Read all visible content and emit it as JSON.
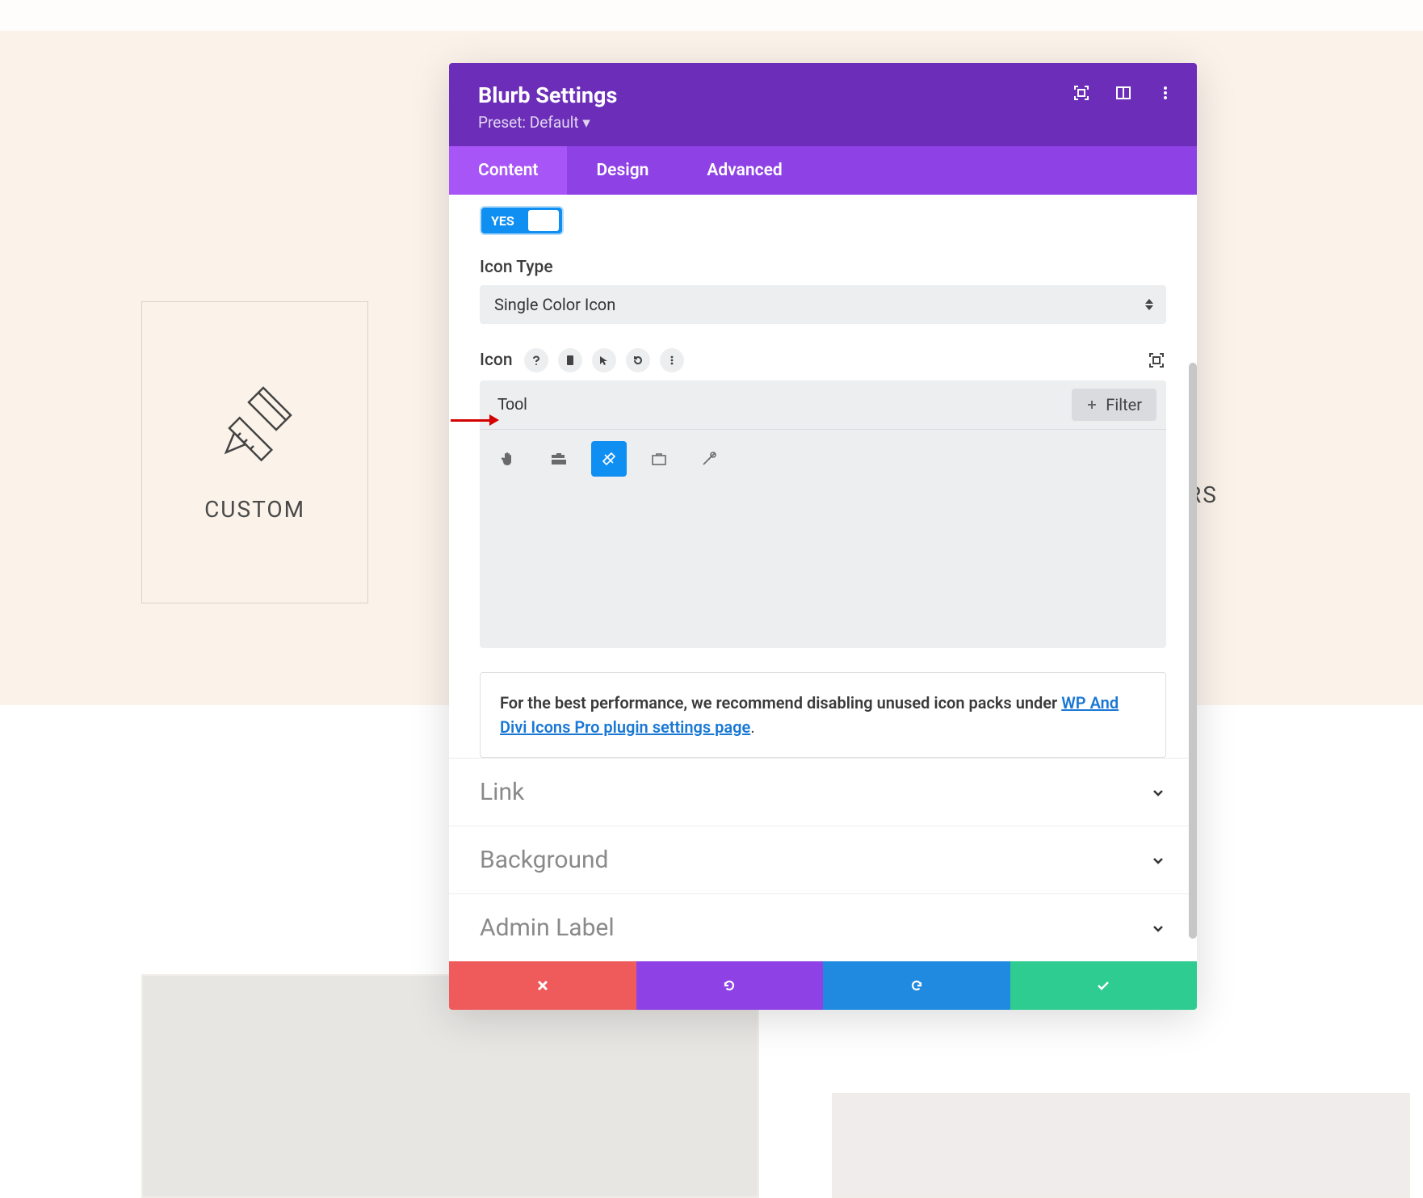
{
  "page": {
    "cards": [
      {
        "label": "CUSTOM"
      },
      {
        "label": "REPAIRS"
      }
    ]
  },
  "modal": {
    "title": "Blurb Settings",
    "preset": "Preset: Default ▾",
    "tabs": {
      "content": "Content",
      "design": "Design",
      "advanced": "Advanced"
    },
    "toggle": {
      "value": "YES"
    },
    "icon_type_label": "Icon Type",
    "icon_type_value": "Single Color Icon",
    "icon_label": "Icon",
    "search_value": "Tool",
    "filter_label": "Filter",
    "icons": [
      "hand-icon",
      "toolbox-icon",
      "pencil-ruler-icon",
      "briefcase-icon",
      "wrench-screwdriver-icon"
    ],
    "selected_icon_index": 2,
    "info": {
      "prefix": "For the best performance, we recommend disabling unused icon packs under ",
      "link": "WP And Divi Icons Pro plugin settings page",
      "suffix": "."
    },
    "accordions": {
      "link": "Link",
      "background": "Background",
      "admin_label": "Admin Label"
    }
  }
}
